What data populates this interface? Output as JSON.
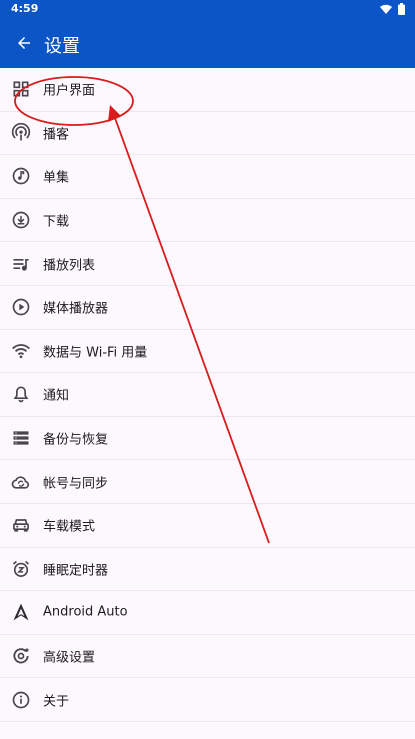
{
  "status_bar": {
    "time": "4:59",
    "icons": [
      "wifi-icon",
      "battery-icon"
    ]
  },
  "app_bar": {
    "title": "设置",
    "back_icon": "arrow-left-icon"
  },
  "menu": {
    "items": [
      {
        "label": "用户界面",
        "icon": "grid-icon"
      },
      {
        "label": "播客",
        "icon": "podcast-icon"
      },
      {
        "label": "单集",
        "icon": "music-note-icon"
      },
      {
        "label": "下载",
        "icon": "download-icon"
      },
      {
        "label": "播放列表",
        "icon": "playlist-icon"
      },
      {
        "label": "媒体播放器",
        "icon": "play-circle-icon"
      },
      {
        "label": "数据与 Wi-Fi 用量",
        "icon": "wifi-icon"
      },
      {
        "label": "通知",
        "icon": "bell-icon"
      },
      {
        "label": "备份与恢复",
        "icon": "storage-icon"
      },
      {
        "label": "帐号与同步",
        "icon": "cloud-sync-icon"
      },
      {
        "label": "车载模式",
        "icon": "car-icon"
      },
      {
        "label": "睡眠定时器",
        "icon": "alarm-snooze-icon"
      },
      {
        "label": "Android Auto",
        "icon": "android-auto-icon"
      },
      {
        "label": "高级设置",
        "icon": "advanced-settings-icon"
      },
      {
        "label": "关于",
        "icon": "info-icon"
      }
    ]
  },
  "annotation": {
    "color": "#d81b1b"
  },
  "colors": {
    "primary": "#0b55c6",
    "background": "#fdf7fe",
    "icon": "#49454f",
    "text": "#1c1b1f"
  }
}
